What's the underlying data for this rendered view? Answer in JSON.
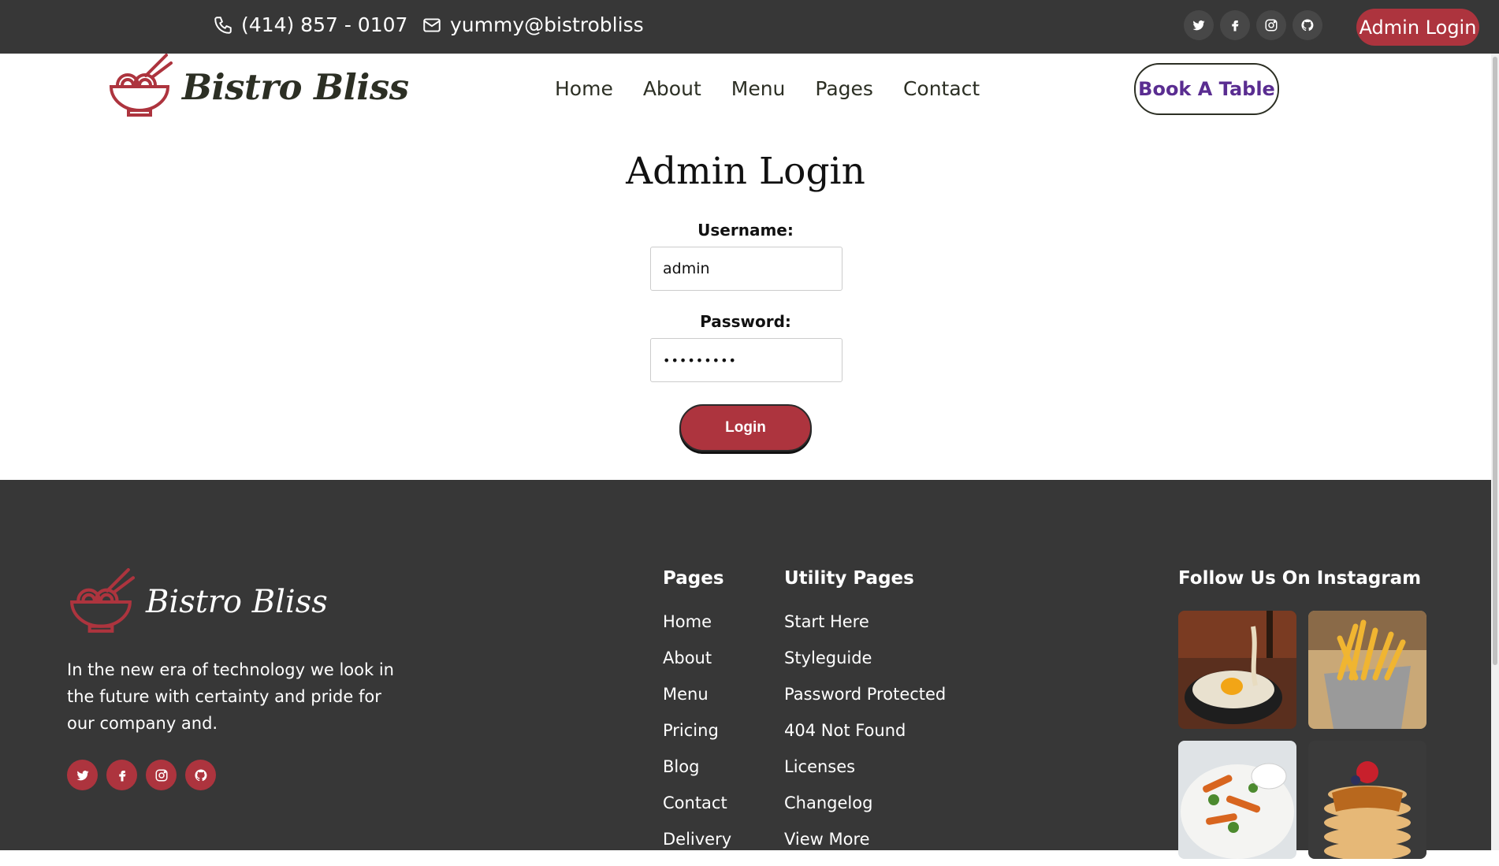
{
  "topbar": {
    "phone": "(414) 857 - 0107",
    "email": "yummy@bistrobliss",
    "socials": [
      "twitter-icon",
      "facebook-icon",
      "instagram-icon",
      "github-icon"
    ],
    "admin_login": "Admin Login"
  },
  "header": {
    "brand": "Bistro Bliss",
    "nav": [
      "Home",
      "About",
      "Menu",
      "Pages",
      "Contact"
    ],
    "book_table": "Book A Table"
  },
  "login": {
    "title": "Admin Login",
    "username_label": "Username:",
    "username_value": "admin",
    "password_label": "Password:",
    "password_value": "•••••••••",
    "button": "Login"
  },
  "footer": {
    "brand": "Bistro Bliss",
    "description": "In the new era of technology we look in the future with certainty and pride for our company and.",
    "pages_heading": "Pages",
    "pages": [
      "Home",
      "About",
      "Menu",
      "Pricing",
      "Blog",
      "Contact",
      "Delivery"
    ],
    "utility_heading": "Utility Pages",
    "utility": [
      "Start Here",
      "Styleguide",
      "Password Protected",
      "404 Not Found",
      "Licenses",
      "Changelog",
      "View More"
    ],
    "instagram_heading": "Follow Us On Instagram"
  },
  "colors": {
    "dark": "#373737",
    "accent": "#ad343e",
    "text": "#2c2f24",
    "book_text": "#5a2d91"
  }
}
